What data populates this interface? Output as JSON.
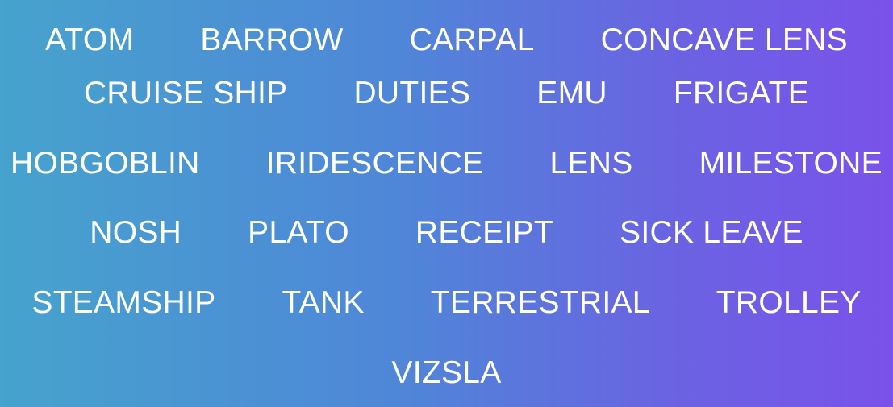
{
  "words": [
    [
      "ATOM",
      "BARROW",
      "CARPAL",
      "CONCAVE LENS"
    ],
    [
      "CRUISE SHIP",
      "DUTIES",
      "EMU",
      "FRIGATE"
    ],
    [
      "HOBGOBLIN",
      "IRIDESCENCE",
      "LENS",
      "MILESTONE"
    ],
    [
      "NOSH",
      "PLATO",
      "RECEIPT",
      "SICK LEAVE"
    ],
    [
      "STEAMSHIP",
      "TANK",
      "TERRESTRIAL",
      "TROLLEY"
    ],
    [
      "VIZSLA"
    ]
  ],
  "colors": {
    "text": "#ffffff",
    "gradient_start": "#46a3cd",
    "gradient_end": "#7a52ea"
  }
}
